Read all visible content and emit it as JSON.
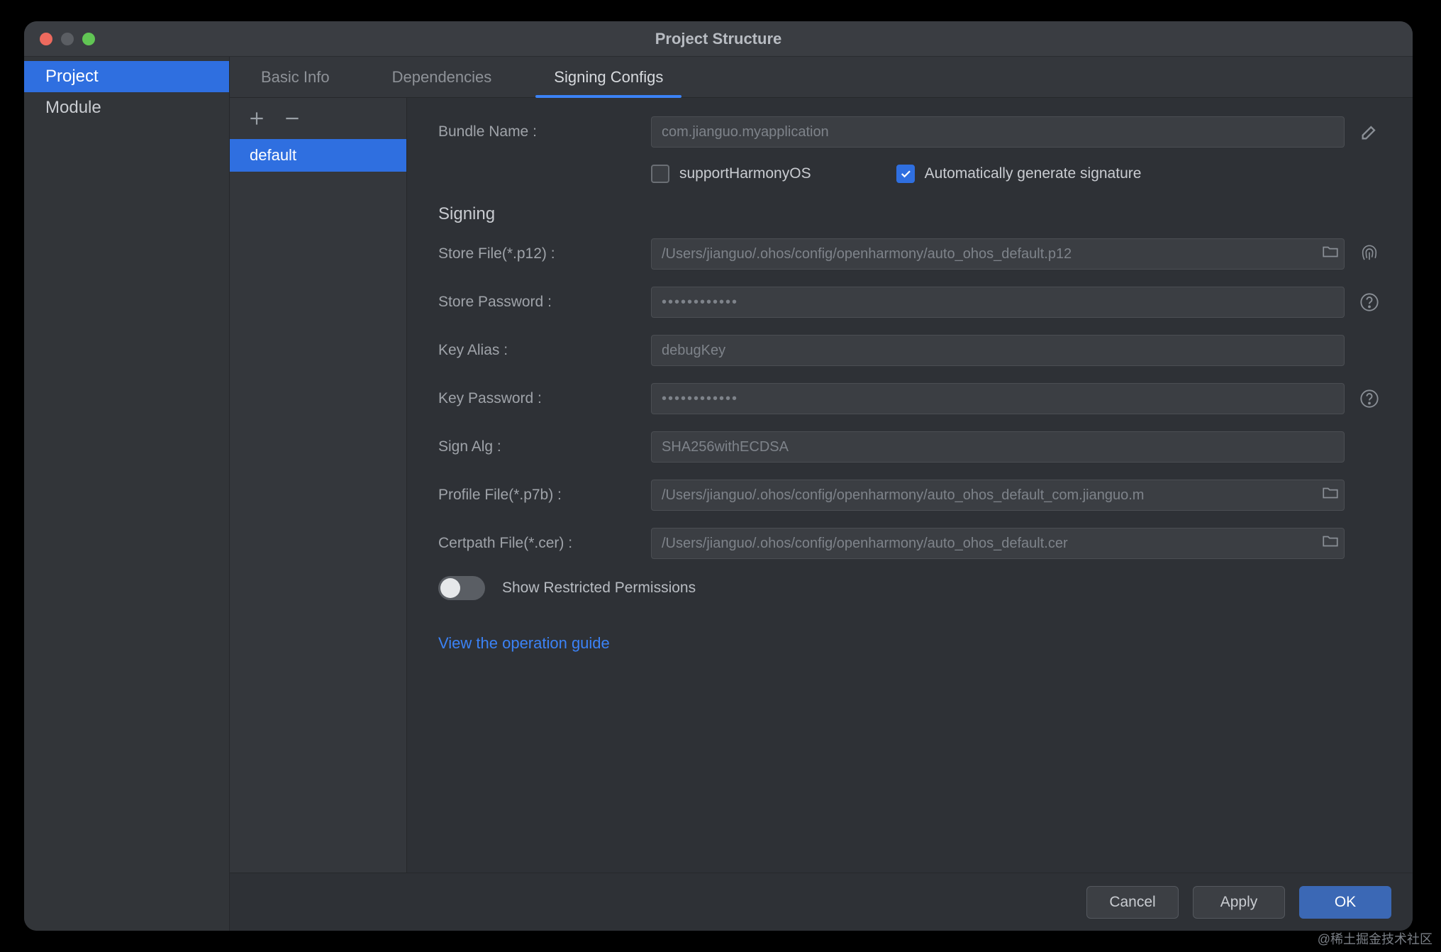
{
  "window": {
    "title": "Project Structure"
  },
  "sidebar": {
    "items": [
      "Project",
      "Module"
    ],
    "selected_index": 0
  },
  "tabs": {
    "items": [
      "Basic Info",
      "Dependencies",
      "Signing Configs"
    ],
    "active_index": 2
  },
  "configlist": {
    "items": [
      "default"
    ],
    "selected_index": 0
  },
  "form": {
    "bundle_name_label": "Bundle Name :",
    "bundle_name_value": "com.jianguo.myapplication",
    "support_label": "supportHarmonyOS",
    "support_checked": false,
    "auto_sign_label": "Automatically generate signature",
    "auto_sign_checked": true,
    "signing_section": "Signing",
    "store_file_label": "Store File(*.p12) :",
    "store_file_value": "/Users/jianguo/.ohos/config/openharmony/auto_ohos_default.p12",
    "store_password_label": "Store Password :",
    "store_password_value": "••••••••••••",
    "key_alias_label": "Key Alias :",
    "key_alias_value": "debugKey",
    "key_password_label": "Key Password :",
    "key_password_value": "••••••••••••",
    "sign_alg_label": "Sign Alg :",
    "sign_alg_value": "SHA256withECDSA",
    "profile_file_label": "Profile File(*.p7b) :",
    "profile_file_value": "/Users/jianguo/.ohos/config/openharmony/auto_ohos_default_com.jianguo.m",
    "certpath_file_label": "Certpath File(*.cer) :",
    "certpath_file_value": "/Users/jianguo/.ohos/config/openharmony/auto_ohos_default.cer",
    "show_restricted_label": "Show Restricted Permissions",
    "show_restricted_on": false,
    "guide_link": "View the operation guide"
  },
  "footer": {
    "cancel": "Cancel",
    "apply": "Apply",
    "ok": "OK"
  },
  "watermark": "@稀土掘金技术社区"
}
